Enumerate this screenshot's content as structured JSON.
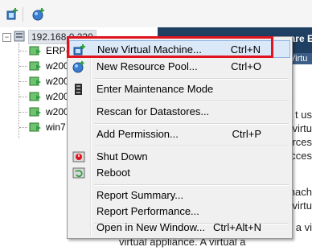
{
  "toolbar": {
    "buttons": [
      "add-host-icon",
      "add-resource-icon"
    ]
  },
  "tree": {
    "root_label": "192.168.0.230",
    "items": [
      {
        "label": "ERP-"
      },
      {
        "label": "w200"
      },
      {
        "label": "w200"
      },
      {
        "label": "w200"
      },
      {
        "label": "w200"
      },
      {
        "label": "win7"
      }
    ]
  },
  "right_pane": {
    "header_title": "ware E",
    "tab_label": "Virtu",
    "text_lines": [
      "t us",
      "virtu",
      "rces",
      "cces",
      "nach",
      "virtu",
      "a vi",
      "virtual appliance. A virtual a"
    ]
  },
  "context_menu": {
    "items": [
      {
        "label": "New Virtual Machine...",
        "shortcut": "Ctrl+N",
        "icon": "new-vm-icon"
      },
      {
        "label": "New Resource Pool...",
        "shortcut": "Ctrl+O",
        "icon": "resource-pool-icon"
      },
      {
        "label": "Enter Maintenance Mode",
        "shortcut": "",
        "icon": "maintenance-icon"
      },
      {
        "label": "Rescan for Datastores...",
        "shortcut": "",
        "icon": ""
      },
      {
        "label": "Add Permission...",
        "shortcut": "Ctrl+P",
        "icon": ""
      },
      {
        "label": "Shut Down",
        "shortcut": "",
        "icon": "shutdown-icon"
      },
      {
        "label": "Reboot",
        "shortcut": "",
        "icon": "reboot-icon"
      },
      {
        "label": "Report Summary...",
        "shortcut": "",
        "icon": ""
      },
      {
        "label": "Report Performance...",
        "shortcut": "",
        "icon": ""
      },
      {
        "label": "Open in New Window...",
        "shortcut": "Ctrl+Alt+N",
        "icon": ""
      }
    ]
  },
  "colors": {
    "highlight_box": "#e0141e",
    "menu_bg": "#f0f0f0",
    "header_bg": "#1f3f63"
  }
}
